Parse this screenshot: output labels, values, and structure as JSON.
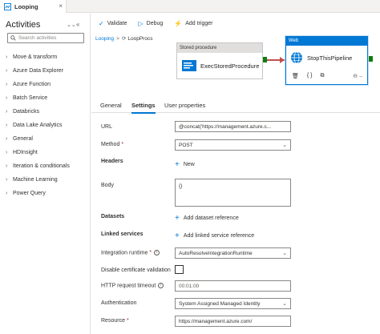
{
  "tab": {
    "title": "Looping"
  },
  "activities": {
    "title": "Activities",
    "search_placeholder": "Search activities",
    "categories": [
      "Move & transform",
      "Azure Data Explorer",
      "Azure Function",
      "Batch Service",
      "Databricks",
      "Data Lake Analytics",
      "General",
      "HDInsight",
      "Iteration & conditionals",
      "Machine Learning",
      "Power Query"
    ]
  },
  "toolbar": {
    "validate": "Validate",
    "debug": "Debug",
    "add_trigger": "Add trigger"
  },
  "breadcrumb": {
    "parent": "Looping",
    "child": "LoopProcs"
  },
  "canvas": {
    "stored_proc": {
      "header": "Stored procedure",
      "name": "ExecStoredProcedure"
    },
    "web": {
      "header": "Web",
      "name": "StopThisPipeline"
    }
  },
  "property_tabs": [
    "General",
    "Settings",
    "User properties"
  ],
  "form": {
    "url": {
      "label": "URL",
      "value": "@concat('https://management.azure.c..."
    },
    "method": {
      "label": "Method",
      "value": "POST"
    },
    "headers": {
      "label": "Headers",
      "add": "New"
    },
    "body": {
      "label": "Body",
      "value": "{}"
    },
    "datasets": {
      "label": "Datasets",
      "add": "Add dataset reference"
    },
    "linked_services": {
      "label": "Linked services",
      "add": "Add linked service reference"
    },
    "integration_runtime": {
      "label": "Integration runtime",
      "value": "AutoResolveIntegrationRuntime"
    },
    "disable_cert": {
      "label": "Disable certificate validation"
    },
    "timeout": {
      "label": "HTTP request timeout",
      "value": "00:01:00"
    },
    "authentication": {
      "label": "Authentication",
      "value": "System Assigned Managed Identity"
    },
    "resource": {
      "label": "Resource",
      "value": "https://management.azure.com/"
    }
  },
  "colors": {
    "accent": "#0078d4",
    "success_port": "#107c10",
    "connector": "#c0504d"
  }
}
